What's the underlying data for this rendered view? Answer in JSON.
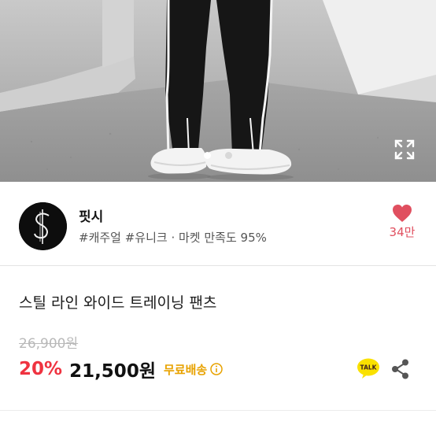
{
  "hero": {
    "image": "product-photo-wide-track-pants",
    "current_slide": 0,
    "slide_count": 2,
    "dot_active_color": "#ffffff",
    "dot_inactive_color": "#d8d8d8",
    "expand_icon": "expand-icon"
  },
  "seller": {
    "avatar_icon": "dollar-sign-logo",
    "name": "핏시",
    "meta": "#캐주얼 #유니크 · 마켓 만족도 95%",
    "like_icon": "heart-icon",
    "like_count": "34만",
    "like_color": "#e04f5f"
  },
  "product": {
    "title": "스틸 라인 와이드 트레이닝 팬츠",
    "original_price": "26,900원",
    "discount": "20%",
    "sale_price": "21,500원",
    "shipping": "무료배송",
    "shipping_info_icon": "info-icon",
    "talk_icon": "kakao-talk-icon",
    "talk_label": "TALK",
    "share_icon": "share-icon",
    "discount_color": "#ef3340",
    "shipping_color": "#e8a200"
  }
}
